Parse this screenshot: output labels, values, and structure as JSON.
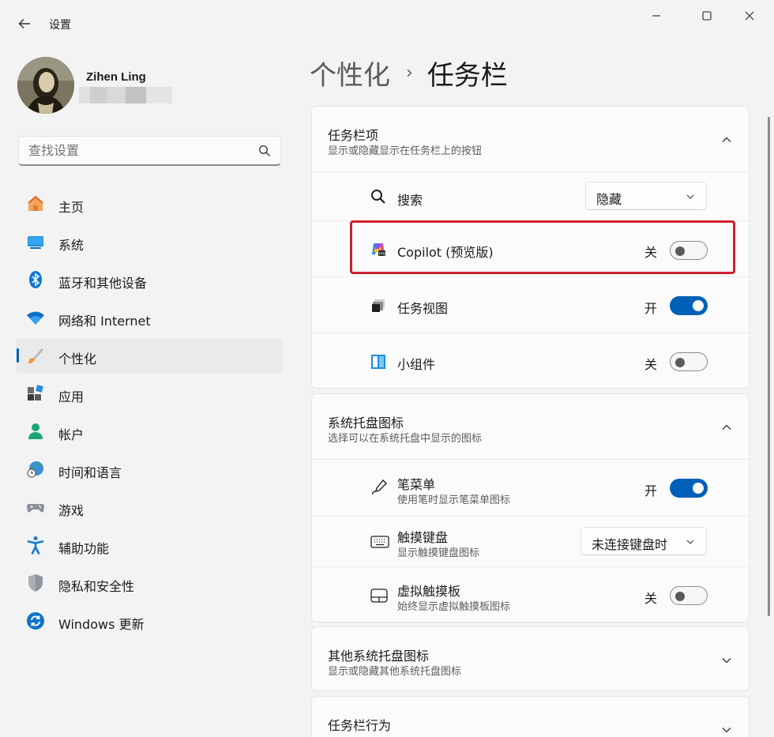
{
  "window": {
    "title": "设置",
    "controls": {
      "minimize": "minimize-icon",
      "maximize": "maximize-icon",
      "close": "close-icon"
    }
  },
  "profile": {
    "name": "Zihen Ling"
  },
  "search": {
    "placeholder": "查找设置"
  },
  "nav": {
    "items": [
      {
        "label": "主页",
        "icon": "home-icon"
      },
      {
        "label": "系统",
        "icon": "system-icon"
      },
      {
        "label": "蓝牙和其他设备",
        "icon": "bluetooth-icon"
      },
      {
        "label": "网络和 Internet",
        "icon": "wifi-icon"
      },
      {
        "label": "个性化",
        "icon": "brush-icon",
        "active": true
      },
      {
        "label": "应用",
        "icon": "apps-icon"
      },
      {
        "label": "帐户",
        "icon": "account-icon"
      },
      {
        "label": "时间和语言",
        "icon": "time-language-icon"
      },
      {
        "label": "游戏",
        "icon": "gamepad-icon"
      },
      {
        "label": "辅助功能",
        "icon": "accessibility-icon"
      },
      {
        "label": "隐私和安全性",
        "icon": "shield-icon"
      },
      {
        "label": "Windows 更新",
        "icon": "update-icon"
      }
    ]
  },
  "breadcrumb": {
    "parent": "个性化",
    "separator": "›",
    "current": "任务栏"
  },
  "taskbar_items": {
    "title": "任务栏项",
    "subtitle": "显示或隐藏显示在任务栏上的按钮",
    "search": {
      "label": "搜索",
      "value": "隐藏"
    },
    "copilot": {
      "label": "Copilot (预览版)",
      "state": "关",
      "on": false
    },
    "task_view": {
      "label": "任务视图",
      "state": "开",
      "on": true
    },
    "widgets": {
      "label": "小组件",
      "state": "关",
      "on": false
    }
  },
  "tray_icons": {
    "title": "系统托盘图标",
    "subtitle": "选择可以在系统托盘中显示的图标",
    "pen_menu": {
      "label": "笔菜单",
      "sub": "使用笔时显示笔菜单图标",
      "state": "开",
      "on": true
    },
    "touch_keyboard": {
      "label": "触摸键盘",
      "sub": "显示触摸键盘图标",
      "value": "未连接键盘时"
    },
    "virtual_touchpad": {
      "label": "虚拟触摸板",
      "sub": "始终显示虚拟触摸板图标",
      "state": "关",
      "on": false
    }
  },
  "other_tray": {
    "title": "其他系统托盘图标",
    "subtitle": "显示或隐藏其他系统托盘图标"
  },
  "taskbar_behavior": {
    "title": "任务栏行为"
  },
  "colors": {
    "accent": "#005fb8",
    "highlight_border": "#d0202e"
  }
}
